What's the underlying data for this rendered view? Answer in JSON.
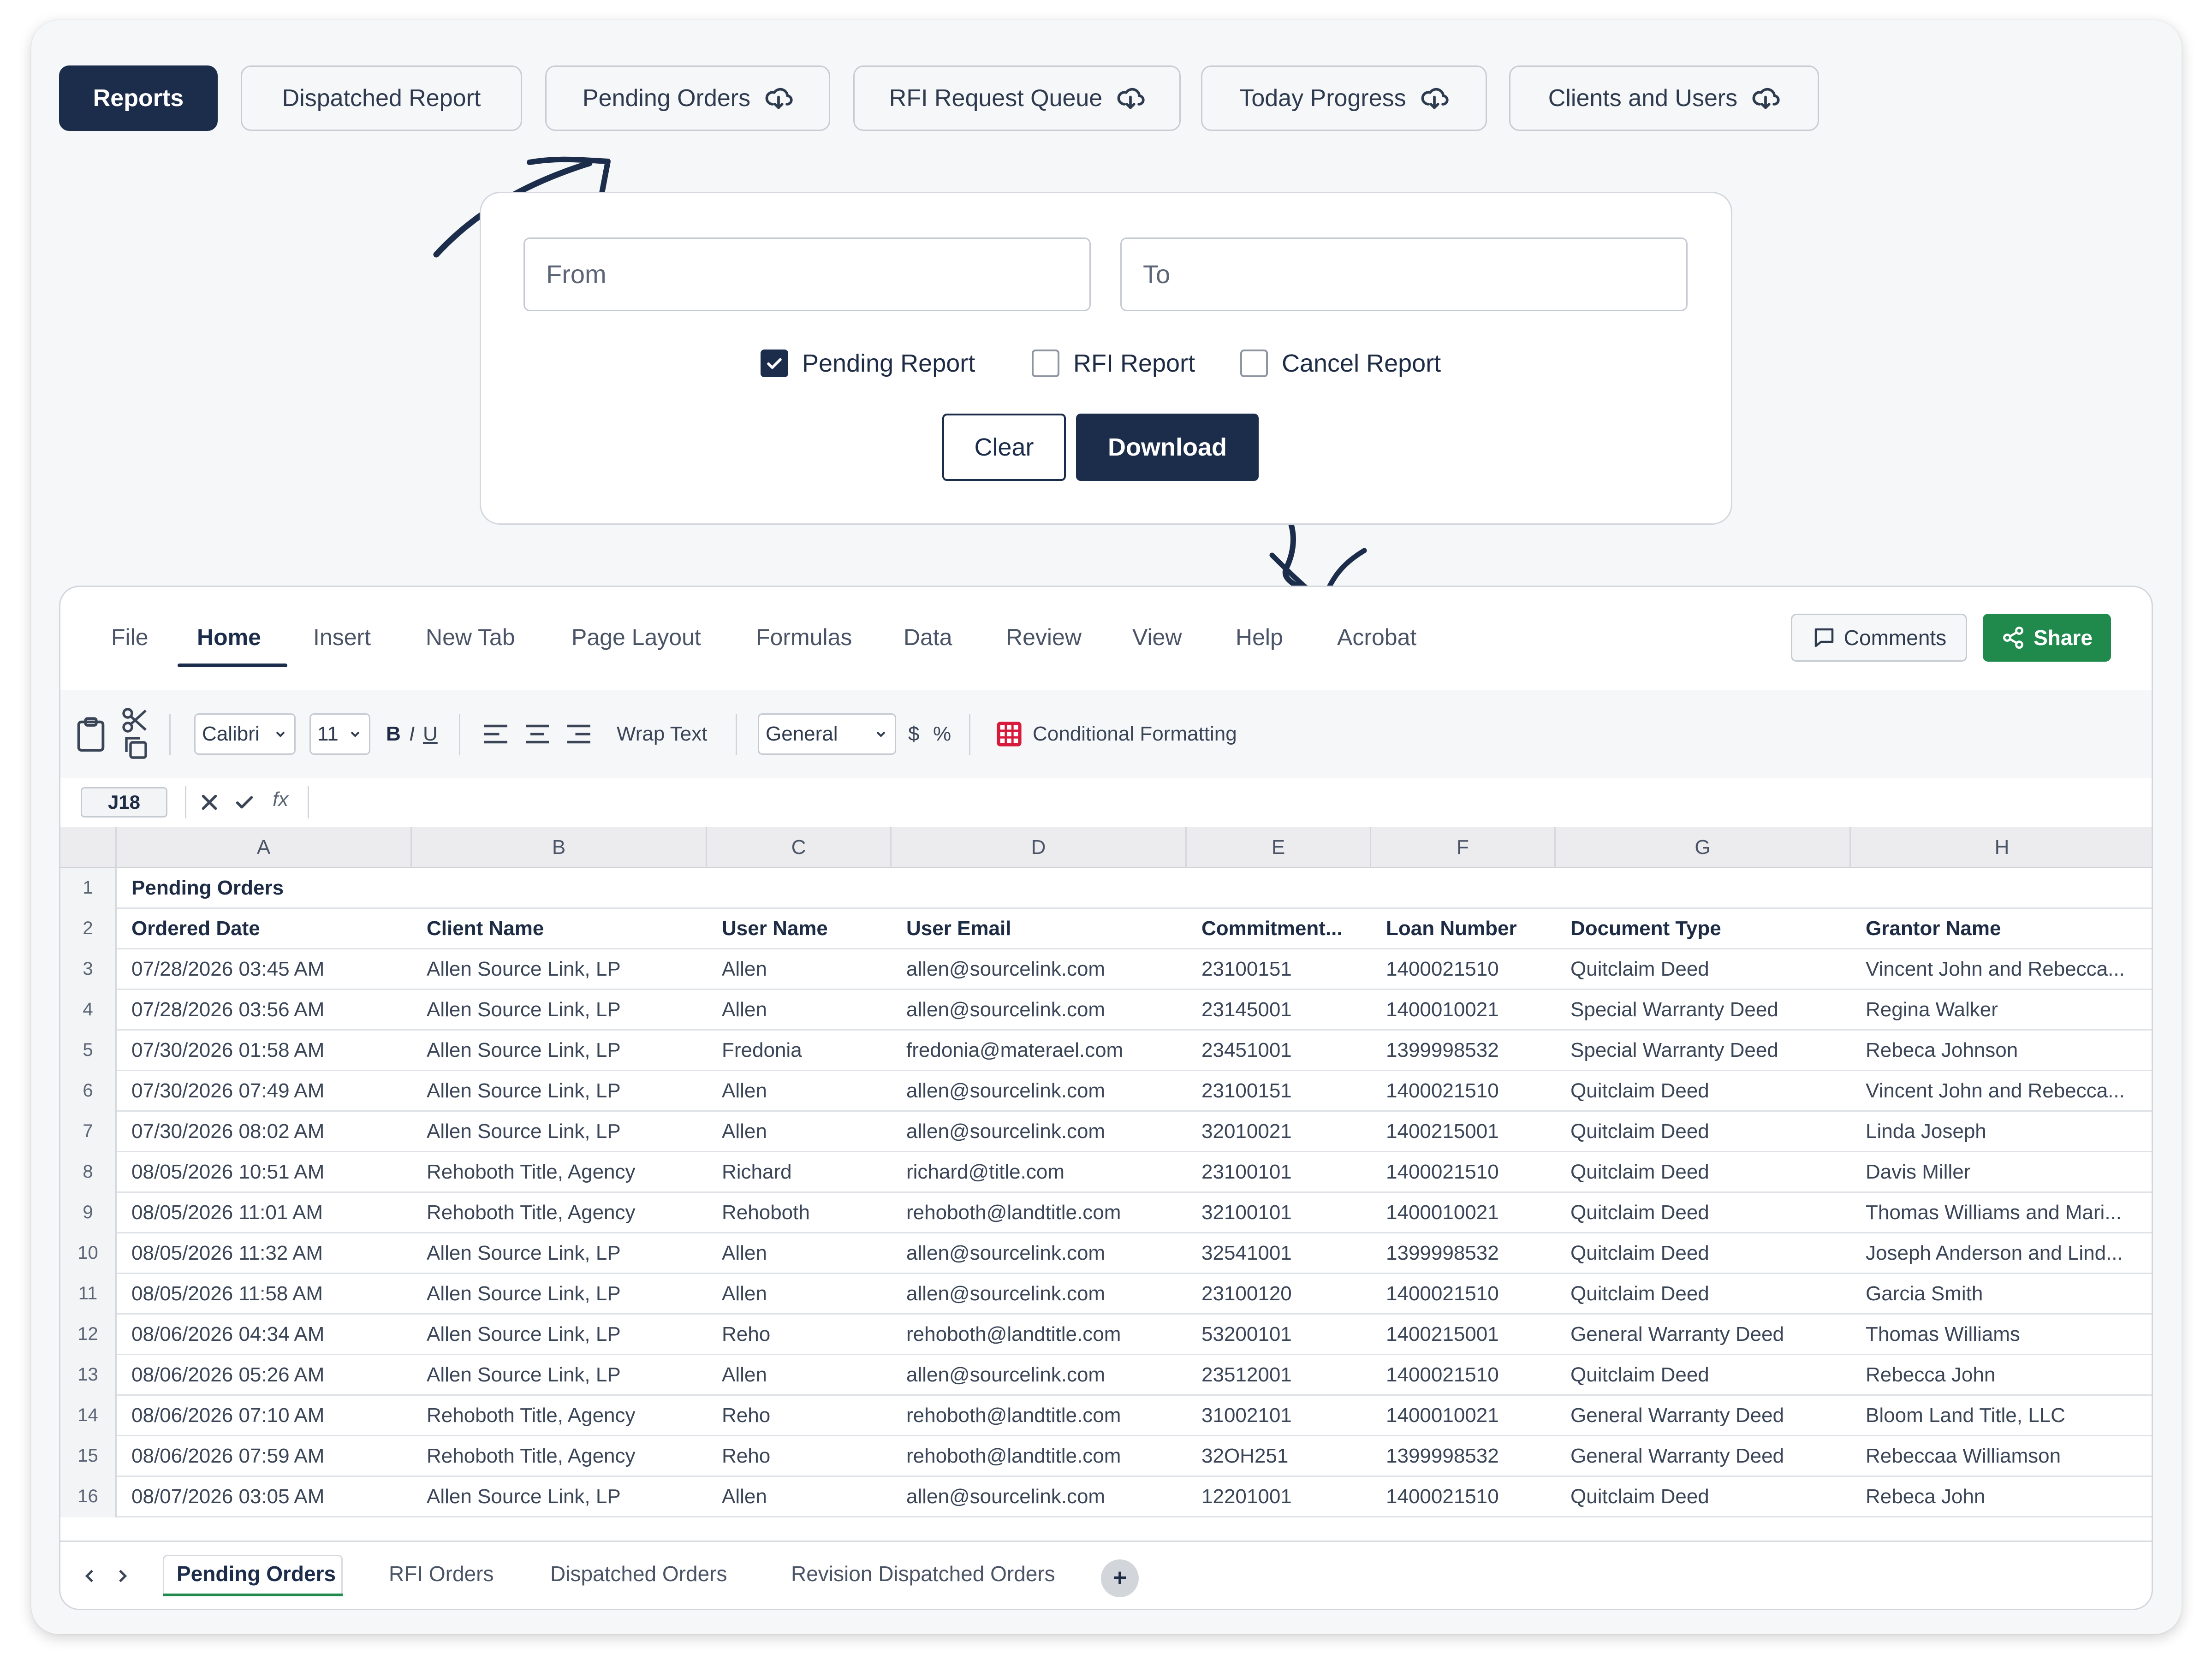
{
  "top_tabs": [
    {
      "label": "Reports",
      "active": true,
      "icon": null
    },
    {
      "label": "Dispatched Report",
      "active": false,
      "icon": null
    },
    {
      "label": "Pending Orders",
      "active": false,
      "icon": "cloud-download-icon"
    },
    {
      "label": "RFI Request Queue",
      "active": false,
      "icon": "cloud-download-icon"
    },
    {
      "label": "Today Progress",
      "active": false,
      "icon": "cloud-download-icon"
    },
    {
      "label": "Clients and Users",
      "active": false,
      "icon": "cloud-download-icon"
    }
  ],
  "filter": {
    "from_placeholder": "From",
    "to_placeholder": "To",
    "checkboxes": [
      {
        "label": "Pending Report",
        "checked": true
      },
      {
        "label": "RFI Report",
        "checked": false
      },
      {
        "label": "Cancel Report",
        "checked": false
      }
    ],
    "clear_label": "Clear",
    "download_label": "Download"
  },
  "ribbon": {
    "tabs": [
      "File",
      "Home",
      "Insert",
      "New Tab",
      "Page Layout",
      "Formulas",
      "Data",
      "Review",
      "View",
      "Help",
      "Acrobat"
    ],
    "active_tab": "Home",
    "comments_label": "Comments",
    "share_label": "Share"
  },
  "toolbar": {
    "font": "Calibri",
    "font_size": "11",
    "bold": "B",
    "italic": "I",
    "underline": "U",
    "wrap_text": "Wrap Text",
    "number_format": "General",
    "currency": "$",
    "percent": "%",
    "conditional_formatting": "Conditional Formatting"
  },
  "formula_bar": {
    "cell_ref": "J18",
    "fx": "fx",
    "value": ""
  },
  "sheet": {
    "columns": [
      "A",
      "B",
      "C",
      "D",
      "E",
      "F",
      "G",
      "H"
    ],
    "rows": [
      {
        "num": "1",
        "cells": [
          "Pending Orders",
          "",
          "",
          "",
          "",
          "",
          "",
          ""
        ]
      },
      {
        "num": "2",
        "cells": [
          "Ordered Date",
          "Client Name",
          "User Name",
          "User Email",
          "Commitment...",
          "Loan Number",
          "Document Type",
          "Grantor Name"
        ]
      },
      {
        "num": "3",
        "cells": [
          "07/28/2026 03:45 AM",
          "Allen Source Link, LP",
          "Allen",
          "allen@sourcelink.com",
          "23100151",
          "1400021510",
          "Quitclaim Deed",
          "Vincent John and Rebecca..."
        ]
      },
      {
        "num": "4",
        "cells": [
          "07/28/2026 03:56 AM",
          "Allen Source Link, LP",
          "Allen",
          "allen@sourcelink.com",
          "23145001",
          "1400010021",
          "Special Warranty Deed",
          "Regina Walker"
        ]
      },
      {
        "num": "5",
        "cells": [
          "07/30/2026 01:58 AM",
          "Allen Source Link, LP",
          "Fredonia",
          "fredonia@materael.com",
          "23451001",
          "1399998532",
          "Special Warranty Deed",
          "Rebeca Johnson"
        ]
      },
      {
        "num": "6",
        "cells": [
          "07/30/2026 07:49 AM",
          "Allen Source Link, LP",
          "Allen",
          "allen@sourcelink.com",
          "23100151",
          "1400021510",
          "Quitclaim Deed",
          "Vincent John and Rebecca..."
        ]
      },
      {
        "num": "7",
        "cells": [
          "07/30/2026 08:02 AM",
          "Allen Source Link, LP",
          "Allen",
          "allen@sourcelink.com",
          "32010021",
          "1400215001",
          "Quitclaim Deed",
          "Linda Joseph"
        ]
      },
      {
        "num": "8",
        "cells": [
          "08/05/2026 10:51 AM",
          "Rehoboth Title, Agency",
          "Richard",
          "richard@title.com",
          "23100101",
          "1400021510",
          "Quitclaim Deed",
          "Davis Miller"
        ]
      },
      {
        "num": "9",
        "cells": [
          "08/05/2026 11:01 AM",
          "Rehoboth Title, Agency",
          "Rehoboth",
          "rehoboth@landtitle.com",
          "32100101",
          "1400010021",
          "Quitclaim Deed",
          "Thomas Williams and Mari..."
        ]
      },
      {
        "num": "10",
        "cells": [
          "08/05/2026 11:32 AM",
          "Allen Source Link, LP",
          "Allen",
          "allen@sourcelink.com",
          "32541001",
          "1399998532",
          "Quitclaim Deed",
          "Joseph Anderson and Lind..."
        ]
      },
      {
        "num": "11",
        "cells": [
          "08/05/2026 11:58 AM",
          "Allen Source Link, LP",
          "Allen",
          "allen@sourcelink.com",
          "23100120",
          "1400021510",
          "Quitclaim Deed",
          "Garcia Smith"
        ]
      },
      {
        "num": "12",
        "cells": [
          "08/06/2026 04:34 AM",
          "Allen Source Link, LP",
          "Reho",
          "rehoboth@landtitle.com",
          "53200101",
          "1400215001",
          "General Warranty Deed",
          "Thomas Williams"
        ]
      },
      {
        "num": "13",
        "cells": [
          "08/06/2026 05:26 AM",
          "Allen Source Link, LP",
          "Allen",
          "allen@sourcelink.com",
          "23512001",
          "1400021510",
          "Quitclaim Deed",
          "Rebecca John"
        ]
      },
      {
        "num": "14",
        "cells": [
          "08/06/2026 07:10 AM",
          "Rehoboth Title, Agency",
          "Reho",
          "rehoboth@landtitle.com",
          "31002101",
          "1400010021",
          "General Warranty Deed",
          "Bloom Land Title, LLC"
        ]
      },
      {
        "num": "15",
        "cells": [
          "08/06/2026 07:59 AM",
          "Rehoboth Title, Agency",
          "Reho",
          "rehoboth@landtitle.com",
          "32OH251",
          "1399998532",
          "General Warranty Deed",
          "Rebeccaa Williamson"
        ]
      },
      {
        "num": "16",
        "cells": [
          "08/07/2026 03:05 AM",
          "Allen Source Link, LP",
          "Allen",
          "allen@sourcelink.com",
          "12201001",
          "1400021510",
          "Quitclaim Deed",
          "Rebeca John"
        ]
      }
    ],
    "tabs": [
      "Pending Orders",
      "RFI Orders",
      "Dispatched Orders",
      "Revision Dispatched Orders"
    ],
    "active_sheet": "Pending Orders",
    "add_sheet_label": "+"
  },
  "colors": {
    "primary": "#1c2c4b",
    "share_green": "#1f8a4c",
    "conditional_icon": "#d81b3c"
  }
}
